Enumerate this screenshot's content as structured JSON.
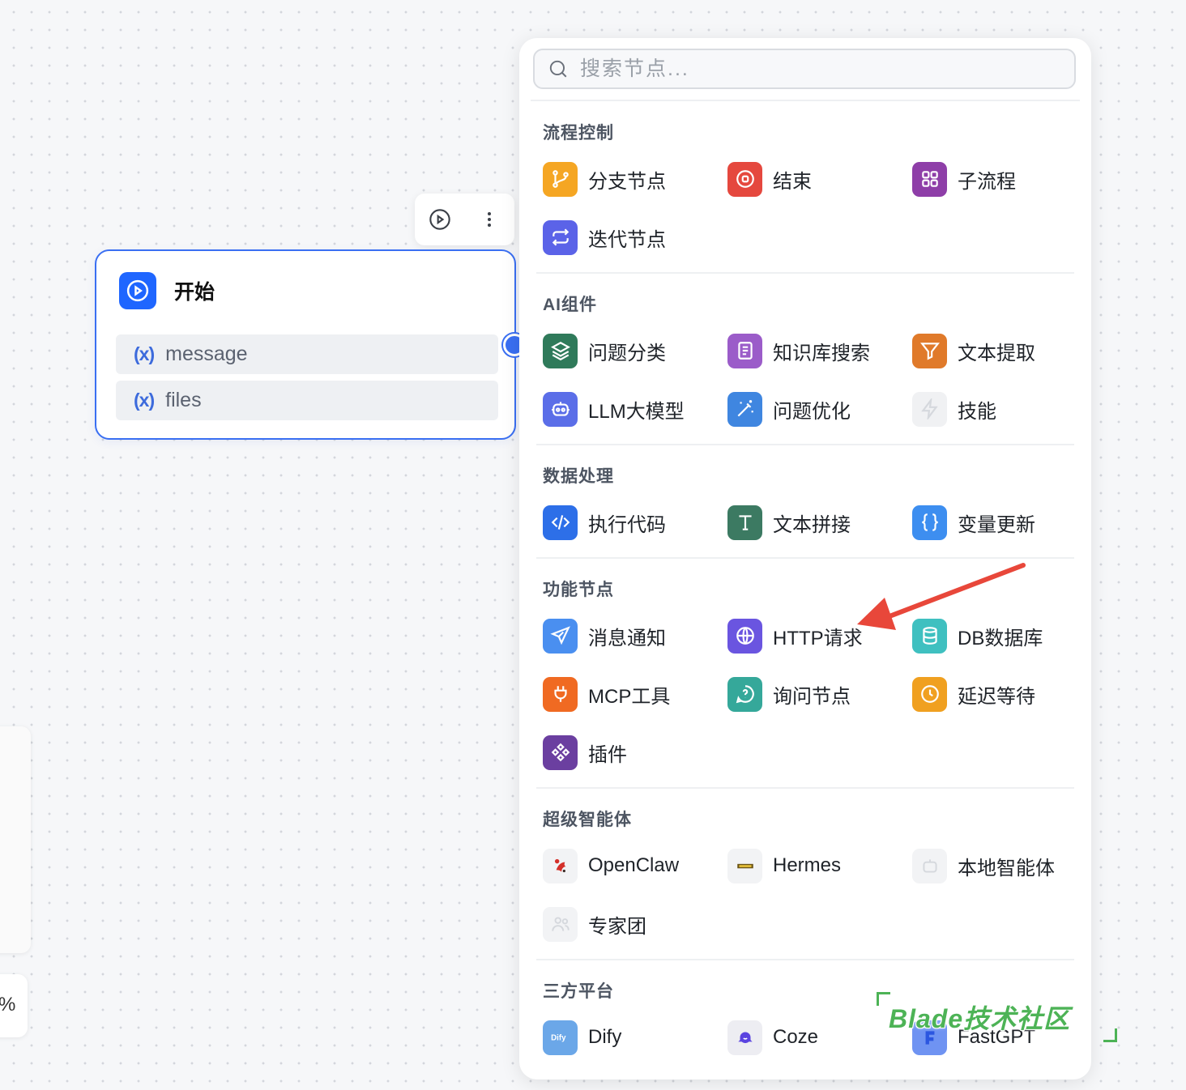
{
  "start_node": {
    "title": "开始",
    "variables": [
      "message",
      "files"
    ],
    "var_symbol": "(x)"
  },
  "side_widget_text": "%",
  "search": {
    "placeholder": "搜索节点..."
  },
  "sections": [
    {
      "title": "流程控制",
      "items": [
        {
          "label": "分支节点",
          "icon": "branch-icon",
          "color": "#f5a623"
        },
        {
          "label": "结束",
          "icon": "stop-circle-icon",
          "color": "#e5483e"
        },
        {
          "label": "子流程",
          "icon": "grid-icon",
          "color": "#8e3ea8"
        },
        {
          "label": "迭代节点",
          "icon": "repeat-icon",
          "color": "#5b63e8"
        }
      ]
    },
    {
      "title": "AI组件",
      "items": [
        {
          "label": "问题分类",
          "icon": "layers-icon",
          "color": "#2f7a5a"
        },
        {
          "label": "知识库搜索",
          "icon": "book-icon",
          "color": "#9b5cc9"
        },
        {
          "label": "文本提取",
          "icon": "filter-icon",
          "color": "#e07a2a"
        },
        {
          "label": "LLM大模型",
          "icon": "robot-icon",
          "color": "#5b6ee8"
        },
        {
          "label": "问题优化",
          "icon": "magic-wand-icon",
          "color": "#3f86e0"
        },
        {
          "label": "技能",
          "icon": "lightning-icon",
          "color": "#f0f1f3"
        }
      ]
    },
    {
      "title": "数据处理",
      "items": [
        {
          "label": "执行代码",
          "icon": "code-icon",
          "color": "#2d6fe8"
        },
        {
          "label": "文本拼接",
          "icon": "text-t-icon",
          "color": "#3c7a62"
        },
        {
          "label": "变量更新",
          "icon": "braces-icon",
          "color": "#3d8ef0"
        }
      ]
    },
    {
      "title": "功能节点",
      "items": [
        {
          "label": "消息通知",
          "icon": "send-icon",
          "color": "#4a8ff0"
        },
        {
          "label": "HTTP请求",
          "icon": "globe-icon",
          "color": "#6a55e0"
        },
        {
          "label": "DB数据库",
          "icon": "database-icon",
          "color": "#3fc0c0"
        },
        {
          "label": "MCP工具",
          "icon": "plug-icon",
          "color": "#f06a22"
        },
        {
          "label": "询问节点",
          "icon": "question-chat-icon",
          "color": "#35a89a"
        },
        {
          "label": "延迟等待",
          "icon": "clock-icon",
          "color": "#f0a020"
        },
        {
          "label": "插件",
          "icon": "plugin-icon",
          "color": "#6b3fa0"
        }
      ]
    },
    {
      "title": "超级智能体",
      "items": [
        {
          "label": "OpenClaw",
          "icon": "lobster-icon",
          "color": "#f2f3f5"
        },
        {
          "label": "Hermes",
          "icon": "hermes-logo-icon",
          "color": "#f2f3f5"
        },
        {
          "label": "本地智能体",
          "icon": "robot-outline-icon",
          "color": "#f2f3f5"
        },
        {
          "label": "专家团",
          "icon": "users-icon",
          "color": "#f2f3f5"
        }
      ]
    },
    {
      "title": "三方平台",
      "items": [
        {
          "label": "Dify",
          "icon": "dify-logo-icon",
          "color": "#6ba7e8"
        },
        {
          "label": "Coze",
          "icon": "coze-logo-icon",
          "color": "#ededf2"
        },
        {
          "label": "FastGPT",
          "icon": "fastgpt-logo-icon",
          "color": "#4f7cf0"
        }
      ]
    }
  ],
  "watermark": "Blade技术社区"
}
